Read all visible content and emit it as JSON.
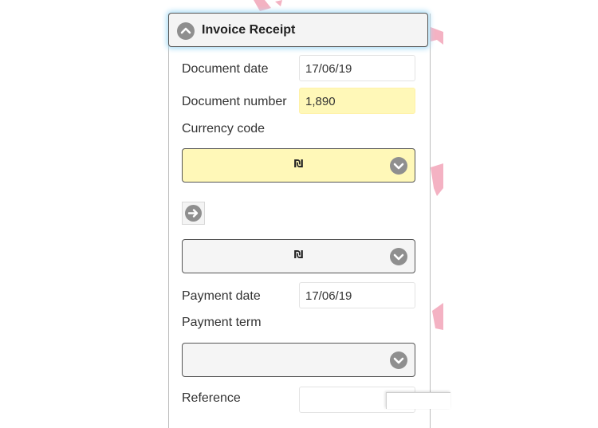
{
  "form": {
    "title": "Invoice Receipt",
    "document_date": {
      "label": "Document date",
      "value": "17/06/19"
    },
    "document_number": {
      "label": "Document number",
      "value": "1,890"
    },
    "currency_code": {
      "label": "Currency code",
      "value": "₪"
    },
    "convert_currency": {
      "value": "₪"
    },
    "payment_date": {
      "label": "Payment date",
      "value": "17/06/19"
    },
    "payment_term": {
      "label": "Payment term",
      "value": ""
    },
    "reference": {
      "label": "Reference",
      "value": ""
    }
  },
  "colors": {
    "required_field": "#fff8b8",
    "header_glow": "#a9dcf5",
    "icon_gray": "#8f8f8f",
    "watermark": "#f2a5b8"
  },
  "icons": [
    "chevron-up-icon",
    "chevron-down-icon",
    "arrow-right-icon"
  ]
}
